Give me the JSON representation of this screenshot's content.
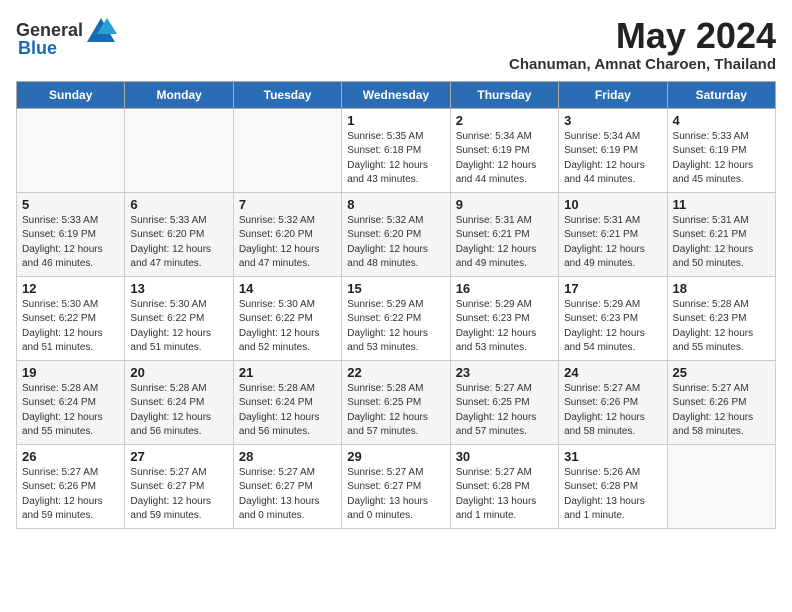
{
  "header": {
    "logo_general": "General",
    "logo_blue": "Blue",
    "month_year": "May 2024",
    "location": "Chanuman, Amnat Charoen, Thailand"
  },
  "days_of_week": [
    "Sunday",
    "Monday",
    "Tuesday",
    "Wednesday",
    "Thursday",
    "Friday",
    "Saturday"
  ],
  "weeks": [
    [
      {
        "day": "",
        "info": ""
      },
      {
        "day": "",
        "info": ""
      },
      {
        "day": "",
        "info": ""
      },
      {
        "day": "1",
        "info": "Sunrise: 5:35 AM\nSunset: 6:18 PM\nDaylight: 12 hours\nand 43 minutes."
      },
      {
        "day": "2",
        "info": "Sunrise: 5:34 AM\nSunset: 6:19 PM\nDaylight: 12 hours\nand 44 minutes."
      },
      {
        "day": "3",
        "info": "Sunrise: 5:34 AM\nSunset: 6:19 PM\nDaylight: 12 hours\nand 44 minutes."
      },
      {
        "day": "4",
        "info": "Sunrise: 5:33 AM\nSunset: 6:19 PM\nDaylight: 12 hours\nand 45 minutes."
      }
    ],
    [
      {
        "day": "5",
        "info": "Sunrise: 5:33 AM\nSunset: 6:19 PM\nDaylight: 12 hours\nand 46 minutes."
      },
      {
        "day": "6",
        "info": "Sunrise: 5:33 AM\nSunset: 6:20 PM\nDaylight: 12 hours\nand 47 minutes."
      },
      {
        "day": "7",
        "info": "Sunrise: 5:32 AM\nSunset: 6:20 PM\nDaylight: 12 hours\nand 47 minutes."
      },
      {
        "day": "8",
        "info": "Sunrise: 5:32 AM\nSunset: 6:20 PM\nDaylight: 12 hours\nand 48 minutes."
      },
      {
        "day": "9",
        "info": "Sunrise: 5:31 AM\nSunset: 6:21 PM\nDaylight: 12 hours\nand 49 minutes."
      },
      {
        "day": "10",
        "info": "Sunrise: 5:31 AM\nSunset: 6:21 PM\nDaylight: 12 hours\nand 49 minutes."
      },
      {
        "day": "11",
        "info": "Sunrise: 5:31 AM\nSunset: 6:21 PM\nDaylight: 12 hours\nand 50 minutes."
      }
    ],
    [
      {
        "day": "12",
        "info": "Sunrise: 5:30 AM\nSunset: 6:22 PM\nDaylight: 12 hours\nand 51 minutes."
      },
      {
        "day": "13",
        "info": "Sunrise: 5:30 AM\nSunset: 6:22 PM\nDaylight: 12 hours\nand 51 minutes."
      },
      {
        "day": "14",
        "info": "Sunrise: 5:30 AM\nSunset: 6:22 PM\nDaylight: 12 hours\nand 52 minutes."
      },
      {
        "day": "15",
        "info": "Sunrise: 5:29 AM\nSunset: 6:22 PM\nDaylight: 12 hours\nand 53 minutes."
      },
      {
        "day": "16",
        "info": "Sunrise: 5:29 AM\nSunset: 6:23 PM\nDaylight: 12 hours\nand 53 minutes."
      },
      {
        "day": "17",
        "info": "Sunrise: 5:29 AM\nSunset: 6:23 PM\nDaylight: 12 hours\nand 54 minutes."
      },
      {
        "day": "18",
        "info": "Sunrise: 5:28 AM\nSunset: 6:23 PM\nDaylight: 12 hours\nand 55 minutes."
      }
    ],
    [
      {
        "day": "19",
        "info": "Sunrise: 5:28 AM\nSunset: 6:24 PM\nDaylight: 12 hours\nand 55 minutes."
      },
      {
        "day": "20",
        "info": "Sunrise: 5:28 AM\nSunset: 6:24 PM\nDaylight: 12 hours\nand 56 minutes."
      },
      {
        "day": "21",
        "info": "Sunrise: 5:28 AM\nSunset: 6:24 PM\nDaylight: 12 hours\nand 56 minutes."
      },
      {
        "day": "22",
        "info": "Sunrise: 5:28 AM\nSunset: 6:25 PM\nDaylight: 12 hours\nand 57 minutes."
      },
      {
        "day": "23",
        "info": "Sunrise: 5:27 AM\nSunset: 6:25 PM\nDaylight: 12 hours\nand 57 minutes."
      },
      {
        "day": "24",
        "info": "Sunrise: 5:27 AM\nSunset: 6:26 PM\nDaylight: 12 hours\nand 58 minutes."
      },
      {
        "day": "25",
        "info": "Sunrise: 5:27 AM\nSunset: 6:26 PM\nDaylight: 12 hours\nand 58 minutes."
      }
    ],
    [
      {
        "day": "26",
        "info": "Sunrise: 5:27 AM\nSunset: 6:26 PM\nDaylight: 12 hours\nand 59 minutes."
      },
      {
        "day": "27",
        "info": "Sunrise: 5:27 AM\nSunset: 6:27 PM\nDaylight: 12 hours\nand 59 minutes."
      },
      {
        "day": "28",
        "info": "Sunrise: 5:27 AM\nSunset: 6:27 PM\nDaylight: 13 hours\nand 0 minutes."
      },
      {
        "day": "29",
        "info": "Sunrise: 5:27 AM\nSunset: 6:27 PM\nDaylight: 13 hours\nand 0 minutes."
      },
      {
        "day": "30",
        "info": "Sunrise: 5:27 AM\nSunset: 6:28 PM\nDaylight: 13 hours\nand 1 minute."
      },
      {
        "day": "31",
        "info": "Sunrise: 5:26 AM\nSunset: 6:28 PM\nDaylight: 13 hours\nand 1 minute."
      },
      {
        "day": "",
        "info": ""
      }
    ]
  ]
}
